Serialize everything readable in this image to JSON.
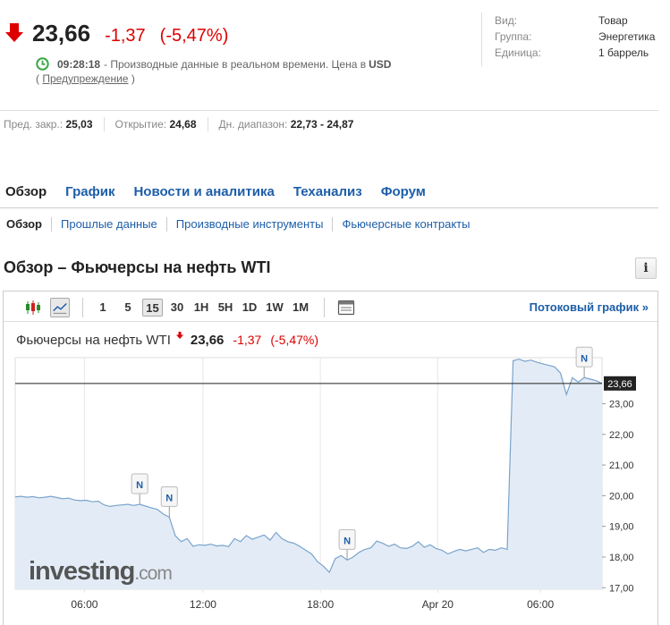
{
  "quote": {
    "price": "23,66",
    "change": "-1,37",
    "change_pct": "(-5,47%)",
    "time": "09:28:18",
    "rt_text": "- Производные данные в реальном времени. Цена в",
    "currency": "USD",
    "warning_open": "(",
    "warning_link": "Предупреждение",
    "warning_close": ")",
    "down_color": "#dd0000"
  },
  "meta": [
    {
      "k": "Вид:",
      "v": "Товар"
    },
    {
      "k": "Группа:",
      "v": "Энергетика"
    },
    {
      "k": "Единица:",
      "v": "1 баррель"
    }
  ],
  "prev": {
    "prev_close_label": "Пред. закр.:",
    "prev_close": "25,03",
    "open_label": "Открытие:",
    "open": "24,68",
    "range_label": "Дн. диапазон:",
    "range": "22,73 - 24,87"
  },
  "tabs": [
    "Обзор",
    "График",
    "Новости и аналитика",
    "Теханализ",
    "Форум"
  ],
  "subtabs": [
    "Обзор",
    "Прошлые данные",
    "Производные инструменты",
    "Фьючерсные контракты"
  ],
  "section_title": "Обзор – Фьючерсы на нефть WTI",
  "info_icon": "i",
  "toolbar": {
    "intervals": [
      "1",
      "5",
      "15",
      "30",
      "1H",
      "5H",
      "1D",
      "1W",
      "1M"
    ],
    "active_interval": "15",
    "stream_label": "Потоковый график",
    "stream_arrow": "»"
  },
  "chart_header": {
    "name": "Фьючерсы на нефть WTI",
    "price": "23,66",
    "change": "-1,37",
    "change_pct": "(-5,47%)"
  },
  "watermark": "investing.com",
  "chart_data": {
    "type": "area",
    "x_ticks": [
      "06:00",
      "12:00",
      "18:00",
      "Apr 20",
      "06:00"
    ],
    "y_ticks": [
      "23,00",
      "22,00",
      "21,00",
      "20,00",
      "19,00",
      "18,00",
      "17,00"
    ],
    "y_tick_values": [
      23,
      22,
      21,
      20,
      19,
      18,
      17
    ],
    "ylim": [
      16.95,
      24.5
    ],
    "last_price_label": "23,66",
    "last_price": 23.66,
    "x_count": 100,
    "series": [
      {
        "values": [
          19.96,
          19.98,
          19.95,
          19.97,
          19.93,
          19.95,
          19.98,
          19.94,
          19.9,
          19.92,
          19.86,
          19.84,
          19.85,
          19.8,
          19.82,
          19.7,
          19.65,
          19.68,
          19.7,
          19.72,
          19.68,
          19.72,
          19.66,
          19.6,
          19.55,
          19.4,
          19.3,
          18.7,
          18.5,
          18.6,
          18.35,
          18.4,
          18.38,
          18.42,
          18.36,
          18.38,
          18.34,
          18.6,
          18.5,
          18.7,
          18.58,
          18.65,
          18.72,
          18.55,
          18.8,
          18.6,
          18.5,
          18.45,
          18.35,
          18.22,
          18.1,
          17.85,
          17.7,
          17.5,
          17.95,
          18.05,
          17.9,
          18.0,
          18.15,
          18.25,
          18.3,
          18.52,
          18.45,
          18.35,
          18.42,
          18.3,
          18.28,
          18.35,
          18.5,
          18.32,
          18.4,
          18.28,
          18.22,
          18.1,
          18.18,
          18.25,
          18.2,
          18.25,
          18.3,
          18.15,
          18.25,
          18.22,
          18.3,
          18.25,
          24.4,
          24.45,
          24.38,
          24.42,
          24.35,
          24.3,
          24.25,
          24.2,
          24.0,
          23.3,
          23.85,
          23.7,
          23.85,
          23.8,
          23.75,
          23.66
        ]
      }
    ],
    "news_markers": [
      {
        "index": 21,
        "label": "N"
      },
      {
        "index": 26,
        "label": "N"
      },
      {
        "index": 56,
        "label": "N"
      },
      {
        "index": 96,
        "label": "N"
      }
    ],
    "grid": "vertical",
    "legend": "none"
  }
}
